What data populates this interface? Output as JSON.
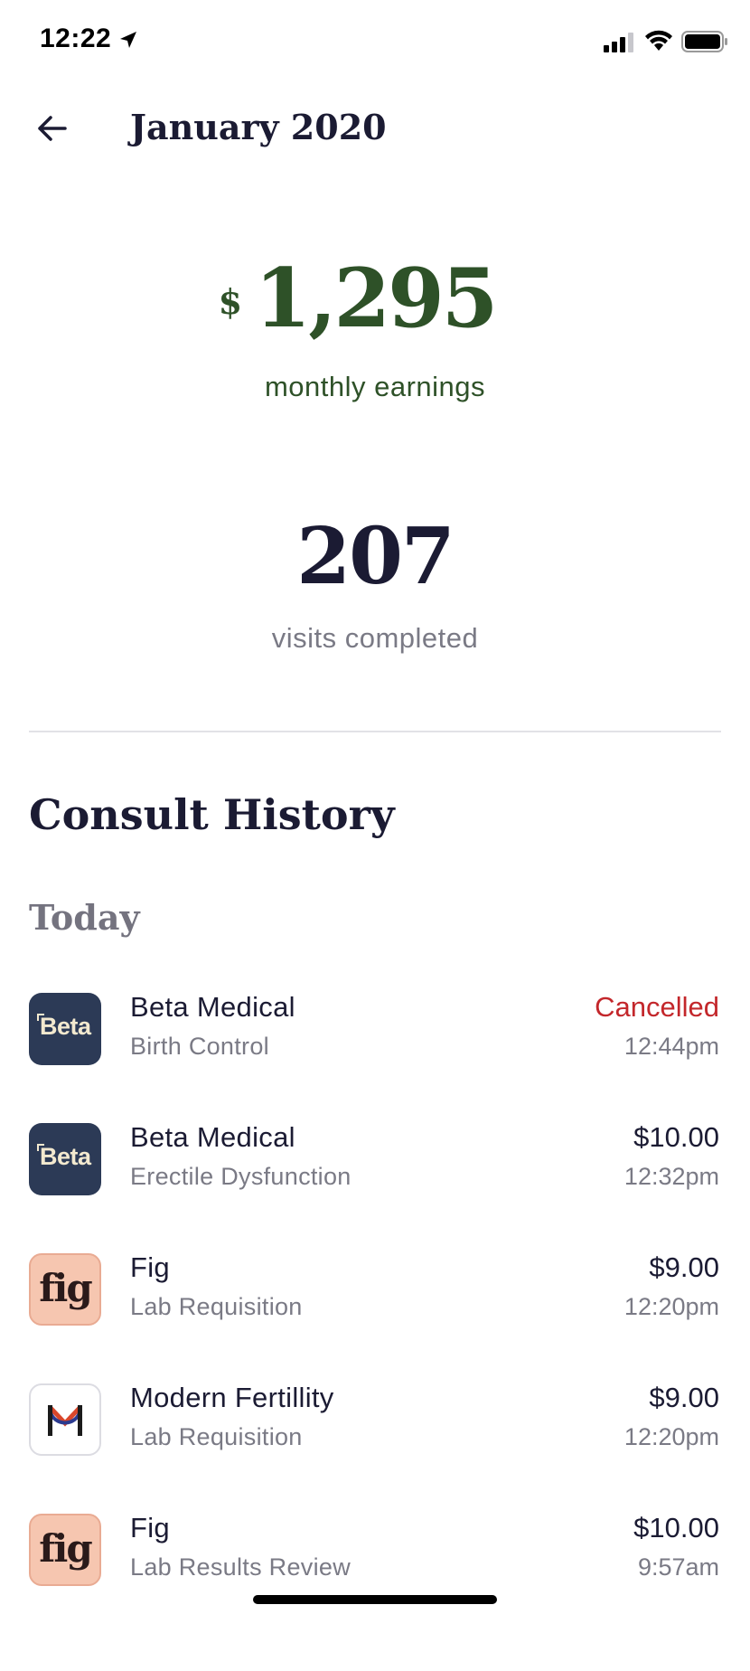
{
  "status_bar": {
    "time": "12:22"
  },
  "header": {
    "title": "January 2020"
  },
  "earnings": {
    "currency": "$",
    "amount": "1,295",
    "label": "monthly earnings"
  },
  "visits": {
    "count": "207",
    "label": "visits completed"
  },
  "consult_history": {
    "title": "Consult History",
    "day_label": "Today",
    "items": [
      {
        "logo": "beta-logo",
        "logo_text": "Beta",
        "name": "Beta Medical",
        "service": "Birth Control",
        "amount": "Cancelled",
        "status": "cancelled",
        "time": "12:44pm"
      },
      {
        "logo": "beta-logo",
        "logo_text": "Beta",
        "name": "Beta Medical",
        "service": "Erectile Dysfunction",
        "amount": "$10.00",
        "status": "paid",
        "time": "12:32pm"
      },
      {
        "logo": "fig-logo",
        "logo_text": "fig",
        "name": "Fig",
        "service": "Lab Requisition",
        "amount": "$9.00",
        "status": "paid",
        "time": "12:20pm"
      },
      {
        "logo": "modern-fertility-logo",
        "logo_text": "",
        "name": "Modern Fertillity",
        "service": "Lab Requisition",
        "amount": "$9.00",
        "status": "paid",
        "time": "12:20pm"
      },
      {
        "logo": "fig-logo",
        "logo_text": "fig",
        "name": "Fig",
        "service": "Lab Results Review",
        "amount": "$10.00",
        "status": "paid",
        "time": "9:57am"
      }
    ]
  },
  "colors": {
    "earnings_green": "#2e5128",
    "title_navy": "#1b1b33",
    "cancelled_red": "#c3272b",
    "muted_gray": "#7a7a85",
    "beta_bg": "#2c3a56",
    "fig_bg": "#f6c6b0"
  }
}
